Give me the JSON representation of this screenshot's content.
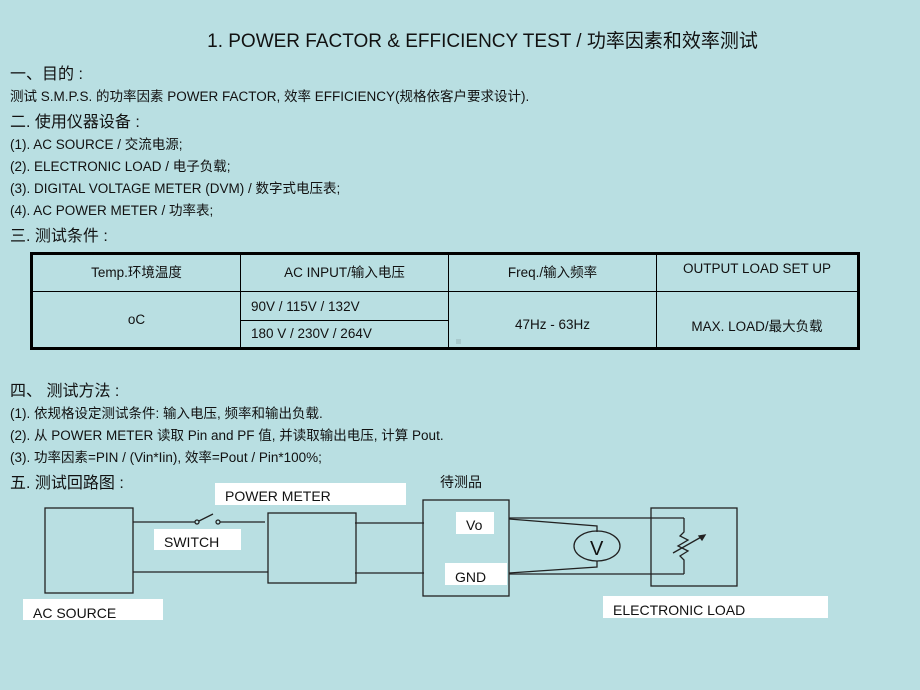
{
  "title": "1.  POWER FACTOR & EFFICIENCY TEST / 功率因素和效率测试",
  "sections": {
    "purpose": {
      "heading": "一、目的 :",
      "text": "测试 S.M.P.S. 的功率因素 POWER FACTOR, 效率 EFFICIENCY(规格依客户要求设计)."
    },
    "instruments": {
      "heading": "二. 使用仪器设备 :",
      "items": [
        "(1). AC SOURCE / 交流电源;",
        "(2). ELECTRONIC LOAD / 电子负载;",
        "(3). DIGITAL VOLTAGE METER (DVM) / 数字式电压表;",
        "(4). AC POWER METER / 功率表;"
      ]
    },
    "conditions": {
      "heading": "三. 测试条件 :",
      "table": {
        "headers": [
          "Temp.环境温度",
          "AC INPUT/输入电压",
          "Freq./输入频率",
          "OUTPUT LOAD SET UP"
        ],
        "temp": "oC",
        "ac_input": [
          "90V  / 115V / 132V",
          "180 V / 230V / 264V"
        ],
        "freq": "47Hz - 63Hz",
        "load": "MAX. LOAD/最大负载"
      }
    },
    "method": {
      "heading": "四、 测试方法 :",
      "items": [
        "(1). 依规格设定测试条件: 输入电压, 频率和输出负载.",
        "(2). 从 POWER METER 读取 Pin and PF 值, 并读取输出电压, 计算 Pout.",
        "(3). 功率因素=PIN / (Vin*Iin), 效率=Pout / Pin*100%;"
      ]
    },
    "circuit": {
      "heading": "五. 测试回路图 :",
      "labels": {
        "ac_source": "AC SOURCE",
        "switch": "SWITCH",
        "power_meter": "POWER METER",
        "dut": "待测品",
        "vo": "Vo",
        "gnd": "GND",
        "voltmeter": "V",
        "electronic_load": "ELECTRONIC LOAD"
      }
    }
  },
  "colors": {
    "background": "#b9dfe2",
    "line": "#000000",
    "label_bg": "#ffffff"
  }
}
